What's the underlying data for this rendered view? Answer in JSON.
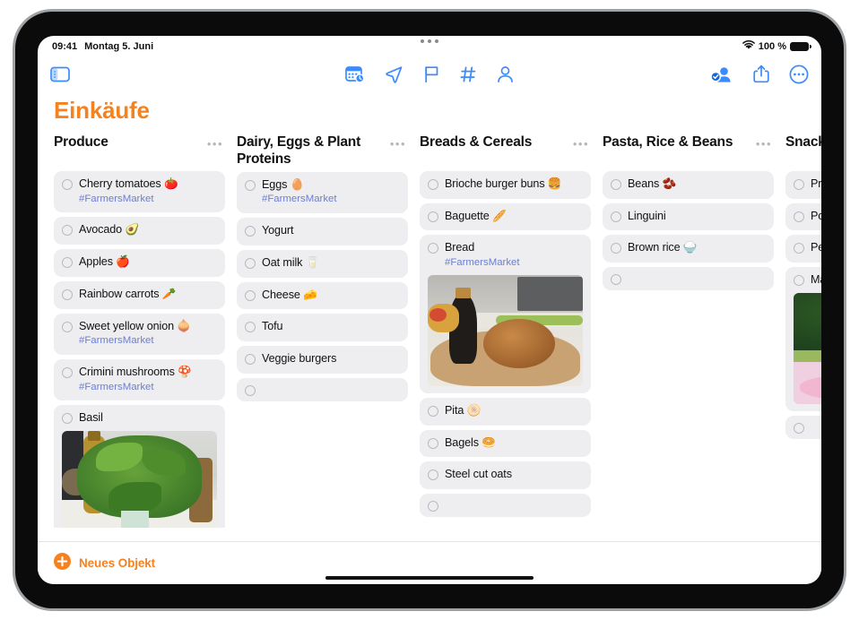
{
  "status_bar": {
    "time": "09:41",
    "date": "Montag 5. Juni",
    "wifi_icon": "wifi-icon",
    "battery_label": "100 %",
    "battery_icon": "battery-full-icon",
    "multitask_handle": "multitask-dots"
  },
  "toolbar": {
    "sidebar_toggle_icon": "sidebar-toggle-icon",
    "center_icons": [
      {
        "name": "reminder-date-icon",
        "label": "Datum"
      },
      {
        "name": "location-arrow-icon",
        "label": "Ort"
      },
      {
        "name": "flag-icon",
        "label": "Flagge"
      },
      {
        "name": "hashtag-icon",
        "label": "Tag"
      },
      {
        "name": "person-icon",
        "label": "Person"
      }
    ],
    "right_icons": [
      {
        "name": "shared-person-check-icon",
        "label": "Geteilt"
      },
      {
        "name": "share-icon",
        "label": "Teilen"
      },
      {
        "name": "more-circle-icon",
        "label": "Mehr"
      }
    ]
  },
  "board": {
    "title": "Einkäufe",
    "accent_color": "#f5821f",
    "tag_color": "#6b7fd0",
    "card_bg": "#eeeef1",
    "menu_glyph": "•••",
    "columns": [
      {
        "title": "Produce",
        "items": [
          {
            "text": "Cherry tomatoes 🍅",
            "tag": "#FarmersMarket"
          },
          {
            "text": "Avocado 🥑"
          },
          {
            "text": "Apples 🍎"
          },
          {
            "text": "Rainbow carrots 🥕"
          },
          {
            "text": "Sweet yellow onion 🧅",
            "tag": "#FarmersMarket"
          },
          {
            "text": "Crimini mushrooms 🍄",
            "tag": "#FarmersMarket"
          },
          {
            "text": "Basil",
            "photo": "basil-photo"
          },
          {
            "text": ""
          }
        ]
      },
      {
        "title": "Dairy, Eggs & Plant Proteins",
        "items": [
          {
            "text": "Eggs 🥚",
            "tag": "#FarmersMarket"
          },
          {
            "text": "Yogurt"
          },
          {
            "text": "Oat milk 🥛"
          },
          {
            "text": "Cheese 🧀"
          },
          {
            "text": "Tofu"
          },
          {
            "text": "Veggie burgers"
          },
          {
            "text": ""
          }
        ]
      },
      {
        "title": "Breads & Cereals",
        "items": [
          {
            "text": "Brioche burger buns 🍔"
          },
          {
            "text": "Baguette 🥖"
          },
          {
            "text": "Bread",
            "tag": "#FarmersMarket",
            "photo": "bread-photo"
          },
          {
            "text": "Pita 🫓"
          },
          {
            "text": "Bagels 🥯"
          },
          {
            "text": "Steel cut oats"
          },
          {
            "text": ""
          }
        ]
      },
      {
        "title": "Pasta, Rice & Beans",
        "items": [
          {
            "text": "Beans 🫘"
          },
          {
            "text": "Linguini"
          },
          {
            "text": "Brown rice 🍚"
          },
          {
            "text": ""
          }
        ]
      },
      {
        "title": "Snacks & Ca",
        "items": [
          {
            "text": "Pretzels 🥨"
          },
          {
            "text": "Popcorn 🍿"
          },
          {
            "text": "Peanuts 🥜"
          },
          {
            "text": "Macarons",
            "photo": "macaron-photo"
          },
          {
            "text": ""
          }
        ]
      }
    ]
  },
  "footer": {
    "new_item_label": "Neues Objekt",
    "new_item_icon": "plus-circle-icon",
    "home_indicator": "home-indicator"
  }
}
